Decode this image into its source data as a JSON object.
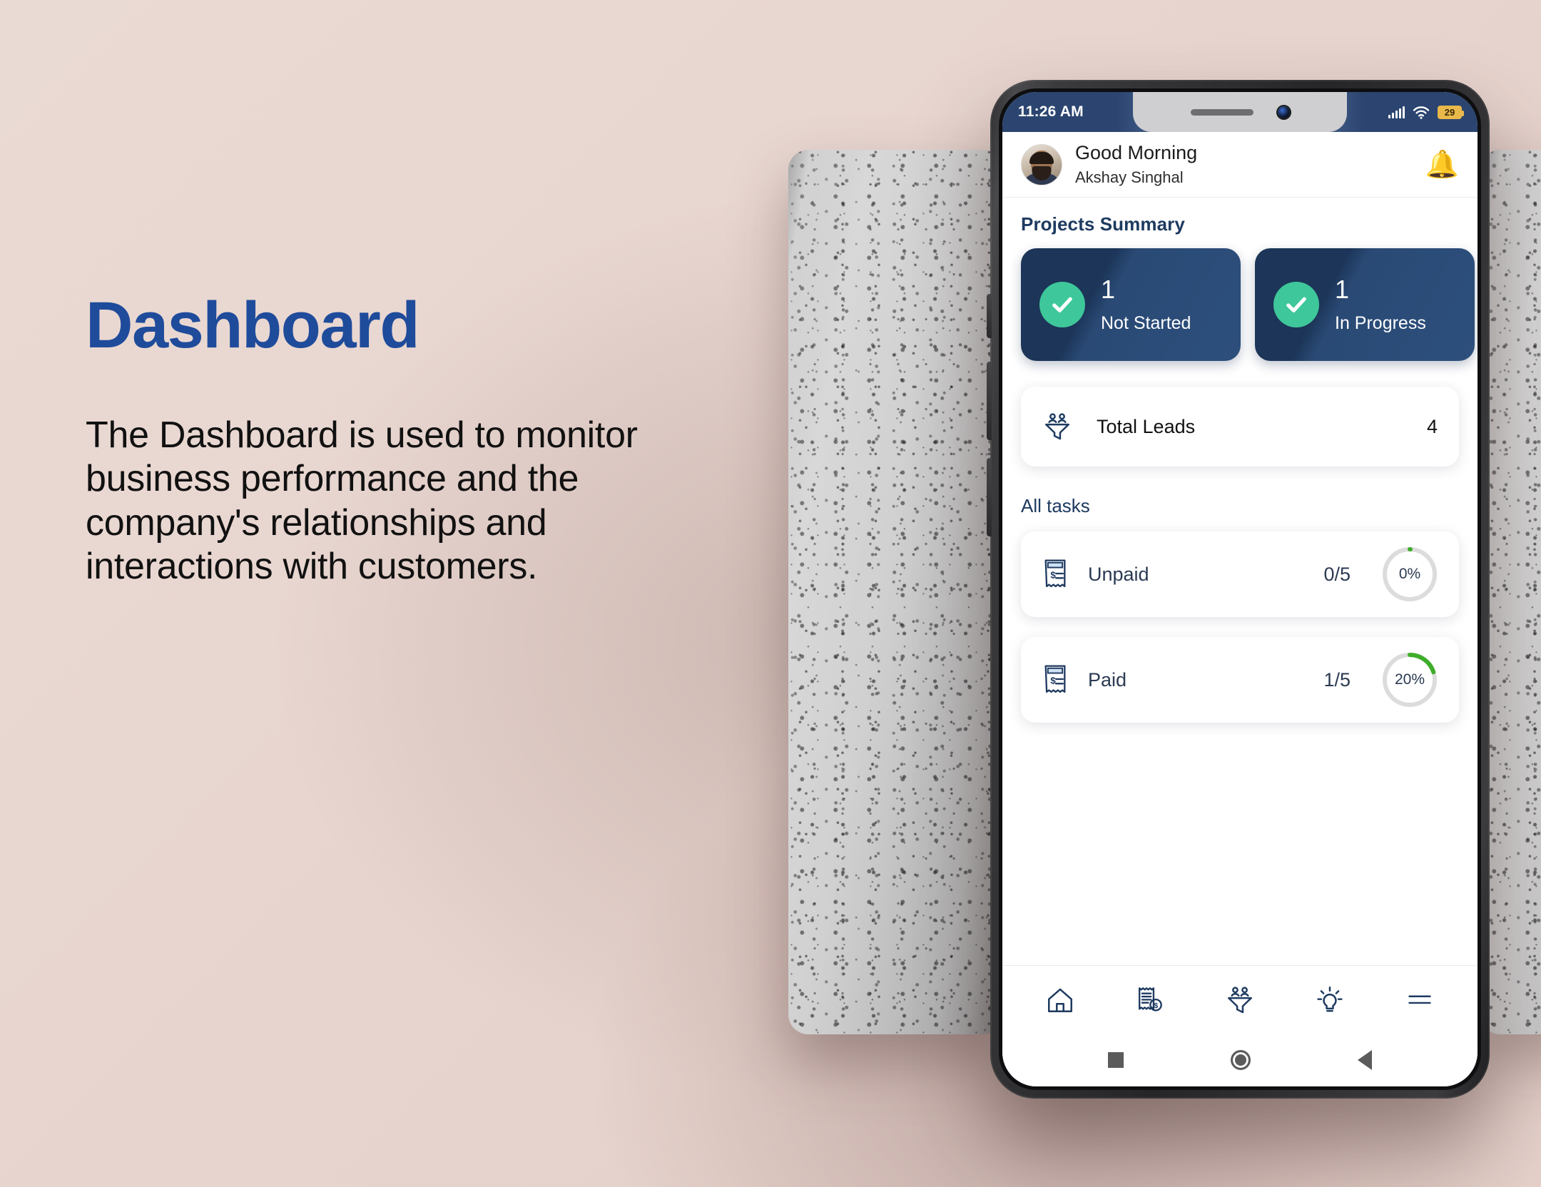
{
  "slide": {
    "headline": "Dashboard",
    "body": "The Dashboard is used to monitor business performance and the company's relationships and interactions with customers.",
    "accent_color": "#1f4b9b",
    "background_color": "#e8d5cf"
  },
  "phone": {
    "status_bar": {
      "time": "11:26 AM",
      "signal_icon": "signal-bars-icon",
      "wifi_icon": "wifi-icon",
      "battery_level": "29",
      "bar_color": "#2b4570"
    },
    "header": {
      "greeting": "Good Morning",
      "user_name": "Akshay Singhal",
      "avatar_icon": "avatar",
      "notification_icon": "bell-icon"
    },
    "projects": {
      "section_title": "Projects Summary",
      "cards": [
        {
          "count": "1",
          "label": "Not Started",
          "status_icon": "check-circle-icon"
        },
        {
          "count": "1",
          "label": "In Progress",
          "status_icon": "check-circle-icon"
        }
      ],
      "card_color": "#1c3558",
      "check_color": "#3ec79a"
    },
    "leads": {
      "icon": "leads-funnel-icon",
      "label": "Total Leads",
      "value": "4"
    },
    "tasks": {
      "section_title": "All tasks",
      "items": [
        {
          "icon": "invoice-icon",
          "label": "Unpaid",
          "fraction": "0/5",
          "percent_label": "0%",
          "percent": 0
        },
        {
          "icon": "invoice-icon",
          "label": "Paid",
          "fraction": "1/5",
          "percent_label": "20%",
          "percent": 20
        }
      ],
      "progress_color": "#3fad2a",
      "track_color": "#dcdcdc"
    },
    "bottom_nav": [
      {
        "icon": "home-icon",
        "label": "Home"
      },
      {
        "icon": "invoice-dollar-icon",
        "label": "Invoices"
      },
      {
        "icon": "leads-funnel-icon",
        "label": "Leads"
      },
      {
        "icon": "lightbulb-icon",
        "label": "Insights"
      },
      {
        "icon": "hamburger-menu-icon",
        "label": "Menu"
      }
    ],
    "android_nav": [
      {
        "icon": "recents-square-icon",
        "label": "Recents"
      },
      {
        "icon": "home-circle-icon",
        "label": "Home"
      },
      {
        "icon": "back-triangle-icon",
        "label": "Back"
      }
    ]
  }
}
